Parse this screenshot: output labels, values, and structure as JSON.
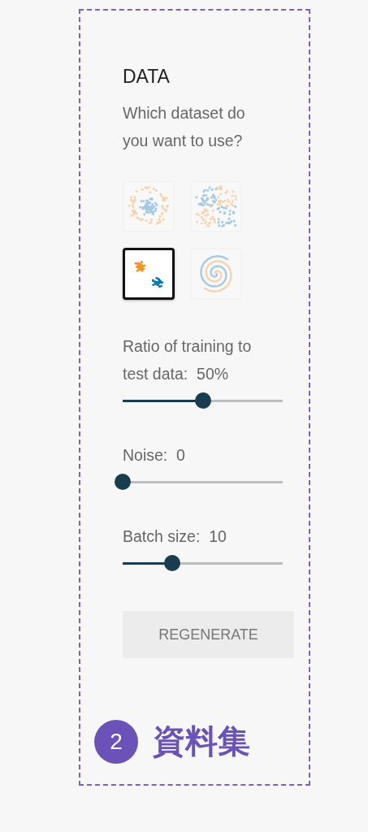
{
  "panel": {
    "title": "DATA",
    "question": "Which dataset do you want to use?"
  },
  "datasets": [
    {
      "kind": "circle",
      "selected": false
    },
    {
      "kind": "xor",
      "selected": false
    },
    {
      "kind": "gauss",
      "selected": true
    },
    {
      "kind": "spiral",
      "selected": false
    }
  ],
  "sliders": [
    {
      "label": "Ratio of training to test data:",
      "value": "50%",
      "level": 0.5
    },
    {
      "label": "Noise:",
      "value": "0",
      "level": 0
    },
    {
      "label": "Batch size:",
      "value": "10",
      "level": 0.31
    }
  ],
  "button": "REGENERATE",
  "caption": {
    "number": "2",
    "text": "資料集"
  }
}
